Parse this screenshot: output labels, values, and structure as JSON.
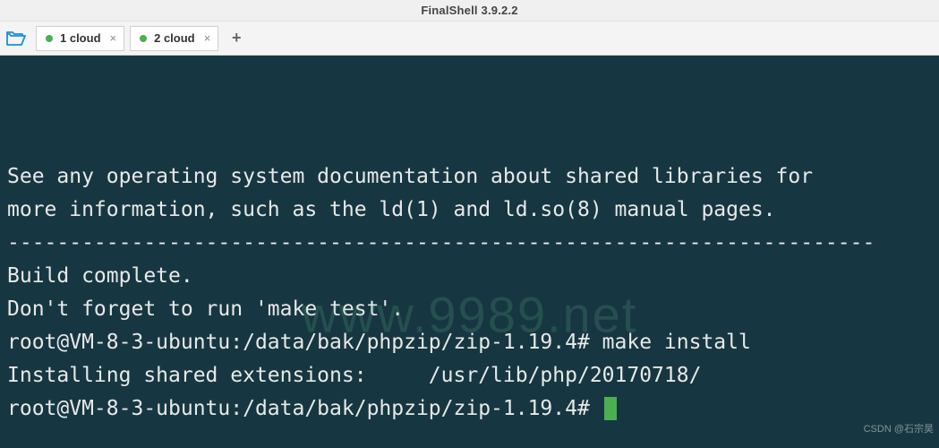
{
  "title": "FinalShell 3.9.2.2",
  "tabs": [
    {
      "label": "1 cloud"
    },
    {
      "label": "2 cloud"
    }
  ],
  "watermark": "www.9989.net",
  "credit": "CSDN @石宗昊",
  "terminal": {
    "lines": [
      "See any operating system documentation about shared libraries for",
      "more information, such as the ld(1) and ld.so(8) manual pages.",
      "----------------------------------------------------------------------",
      "",
      "Build complete.",
      "Don't forget to run 'make test'.",
      "",
      "root@VM-8-3-ubuntu:/data/bak/phpzip/zip-1.19.4# make install",
      "Installing shared extensions:     /usr/lib/php/20170718/",
      "root@VM-8-3-ubuntu:/data/bak/phpzip/zip-1.19.4# "
    ]
  }
}
